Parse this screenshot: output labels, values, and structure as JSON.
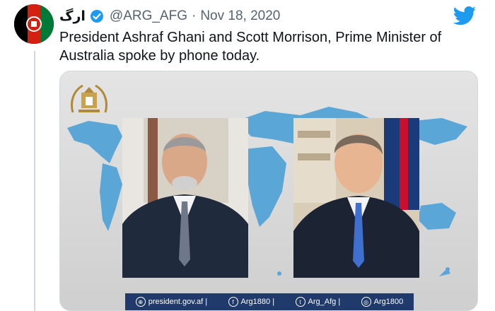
{
  "tweet": {
    "display_name": "ارگ",
    "handle": "@ARG_AFG",
    "separator": "·",
    "date": "Nov 18, 2020",
    "text": "President Ashraf Ghani and Scott Morrison, Prime Minister of Australia spoke by phone today."
  },
  "image": {
    "footer": [
      {
        "icon": "globe-icon",
        "glyph": "⊕",
        "label": "president.gov.af |"
      },
      {
        "icon": "facebook-icon",
        "glyph": "f",
        "label": "Arg1880 |"
      },
      {
        "icon": "twitter-icon",
        "glyph": "t",
        "label": "Arg_Afg |"
      },
      {
        "icon": "instagram-icon",
        "glyph": "◎",
        "label": "Arg1800"
      }
    ]
  },
  "colors": {
    "accent": "#1d9bf0",
    "map_land": "#5aa6d6",
    "footer_bg": "#1f3a6b"
  }
}
